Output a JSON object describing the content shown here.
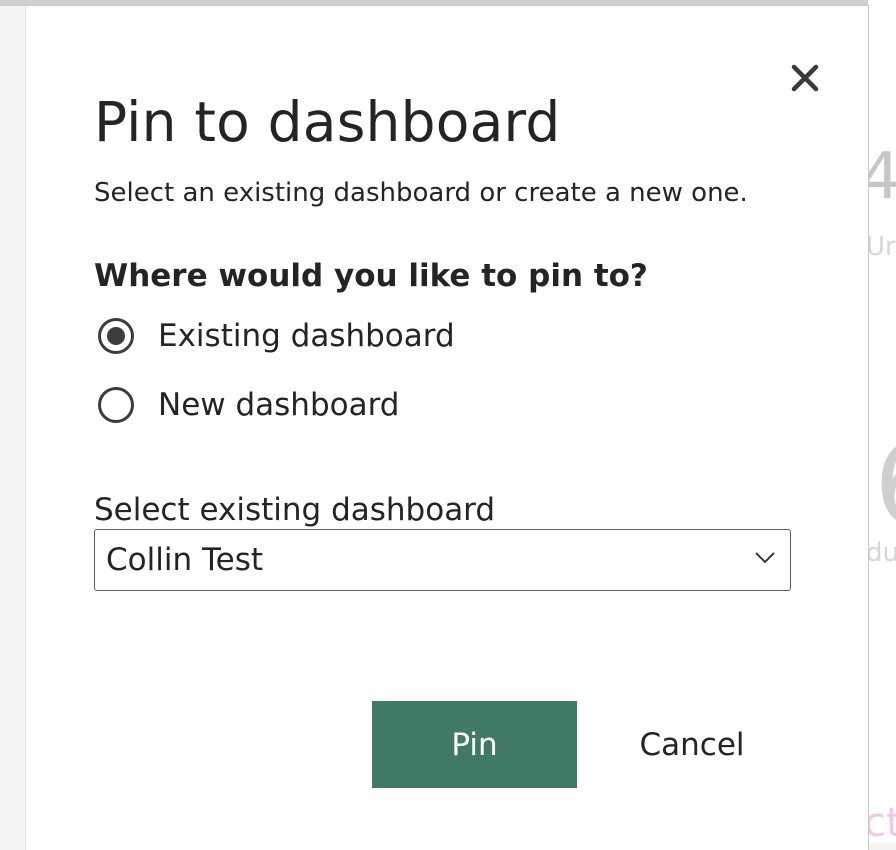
{
  "dialog": {
    "title": "Pin to dashboard",
    "subtitle": "Select an existing dashboard or create a new one.",
    "close_icon": "close-icon",
    "question": "Where would you like to pin to?",
    "options": [
      {
        "label": "Existing dashboard",
        "checked": true
      },
      {
        "label": "New dashboard",
        "checked": false
      }
    ],
    "select": {
      "label": "Select existing dashboard",
      "value": "Collin Test",
      "icon": "chevron-down-icon"
    },
    "pin_label": "Pin",
    "cancel_label": "Cancel",
    "accent_color": "#407965"
  },
  "background": {
    "glyphs": [
      "4",
      "Ur",
      "6",
      "du",
      "ct"
    ]
  }
}
